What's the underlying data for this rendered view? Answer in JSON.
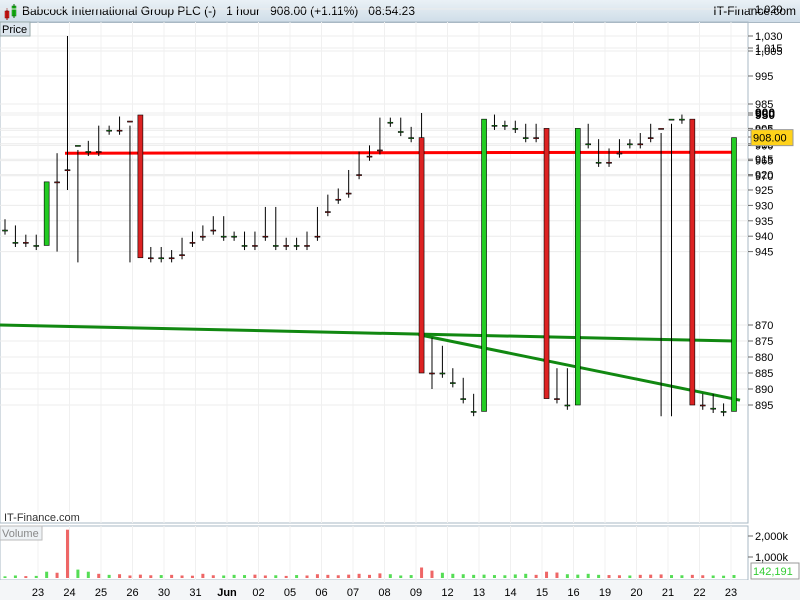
{
  "header": {
    "title": "Babcock International Group PLC (-)   1 hour   908.00 (+1.11%)   08:54:23",
    "site": "IT-Finance.com"
  },
  "panels": {
    "price_label": "Price",
    "volume_label": "Volume",
    "watermark": "IT-Finance.com"
  },
  "colors": {
    "up": "#22cc22",
    "down": "#dd2222",
    "resistance": "#ff0000",
    "support": "#118811",
    "last_bg": "#ffd21a"
  },
  "chart_data": {
    "type": "candlestick",
    "title": "Babcock International Group PLC (-) 1 hour",
    "last_price": "908.00",
    "last_volume": "142,191",
    "x_ticks": [
      "23",
      "24",
      "25",
      "26",
      "30",
      "31",
      "Jun",
      "02",
      "05",
      "06",
      "07",
      "08",
      "09",
      "12",
      "13",
      "14",
      "15",
      "16",
      "19",
      "20",
      "21",
      "22",
      "23"
    ],
    "y_ticks": [
      {
        "v": 1030,
        "label": "1,030"
      },
      {
        "v": 1020,
        "label": "1,020"
      },
      {
        "v": 1015,
        "label": "1,015"
      },
      {
        "v": 1005,
        "label": "1,005"
      },
      {
        "v": 995,
        "label": "995"
      },
      {
        "v": 985,
        "label": "985"
      },
      {
        "v": 975,
        "label": "975"
      },
      {
        "v": 970,
        "label": "970"
      },
      {
        "v": 965,
        "label": "965"
      },
      {
        "v": 960,
        "label": "960"
      },
      {
        "v": 955,
        "label": "955"
      },
      {
        "v": 950,
        "label": "950",
        "bold": true
      },
      {
        "v": 945,
        "label": "945"
      },
      {
        "v": 940,
        "label": "940"
      },
      {
        "v": 935,
        "label": "935"
      },
      {
        "v": 930,
        "label": "930"
      },
      {
        "v": 925,
        "label": "925"
      },
      {
        "v": 920,
        "label": "920"
      },
      {
        "v": 915,
        "label": "915"
      },
      {
        "v": 910,
        "label": "910"
      },
      {
        "v": 905,
        "label": "905"
      },
      {
        "v": 900,
        "label": "900",
        "bold": true
      },
      {
        "v": 895,
        "label": "895"
      },
      {
        "v": 890,
        "label": "890"
      },
      {
        "v": 885,
        "label": "885"
      },
      {
        "v": 880,
        "label": "880"
      },
      {
        "v": 875,
        "label": "875"
      },
      {
        "v": 870,
        "label": "870"
      }
    ],
    "volume_ticks": [
      "2,000k",
      "1,000k"
    ],
    "closes": [
      938,
      942,
      941,
      943,
      972,
      968,
      950,
      960,
      962,
      955,
      955,
      952,
      950,
      947,
      945,
      947,
      946,
      942,
      940,
      938,
      935,
      940,
      940,
      943,
      940,
      932,
      943,
      942,
      943,
      940,
      932,
      928,
      926,
      920,
      914,
      912,
      903,
      903,
      906,
      908,
      885,
      878,
      885,
      888,
      893,
      897,
      902,
      904,
      904,
      905,
      908,
      905,
      893,
      885,
      895,
      905,
      910,
      916,
      913,
      910,
      910,
      908,
      905,
      900,
      902,
      902,
      895,
      893,
      896,
      897,
      908
    ],
    "first_open": 936,
    "extremes": [
      {
        "index": 6,
        "high": 1030,
        "low": 925
      },
      {
        "index": 5,
        "high": 981,
        "low": 945
      },
      {
        "index": 40,
        "high": 900,
        "low": 873
      },
      {
        "index": 41,
        "high": 890,
        "low": 874
      }
    ],
    "volumes_k": [
      80,
      120,
      90,
      100,
      300,
      250,
      2300,
      400,
      300,
      200,
      150,
      180,
      120,
      160,
      130,
      140,
      150,
      120,
      110,
      200,
      130,
      120,
      150,
      140,
      160,
      120,
      130,
      100,
      140,
      120,
      180,
      150,
      130,
      160,
      200,
      150,
      220,
      180,
      120,
      140,
      500,
      350,
      250,
      200,
      180,
      150,
      160,
      140,
      130,
      170,
      200,
      150,
      300,
      260,
      180,
      160,
      200,
      150,
      140,
      130,
      120,
      150,
      160,
      170,
      140,
      130,
      150,
      130,
      120,
      110,
      142
    ],
    "resistance": {
      "price": 981
    },
    "supports": [
      {
        "from_index": 40,
        "from": 873,
        "to": 893.5
      },
      {
        "from_index": 0,
        "from": 870,
        "to": 875
      }
    ]
  }
}
